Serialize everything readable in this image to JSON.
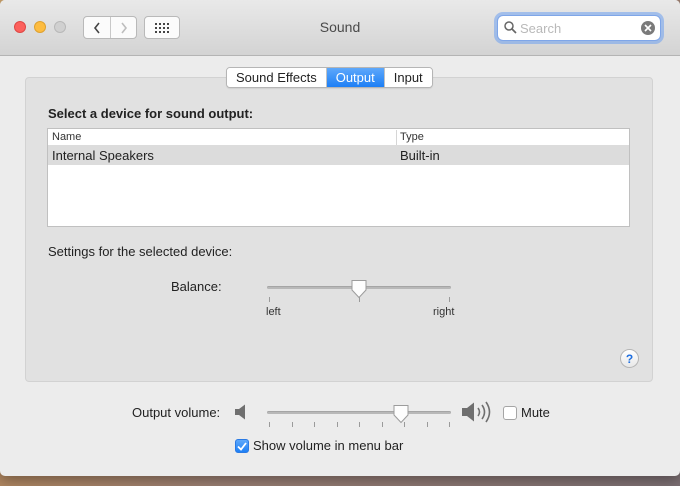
{
  "window": {
    "title": "Sound"
  },
  "search": {
    "placeholder": "Search"
  },
  "tabs": [
    {
      "label": "Sound Effects",
      "active": false
    },
    {
      "label": "Output",
      "active": true
    },
    {
      "label": "Input",
      "active": false
    }
  ],
  "output": {
    "section_title": "Select a device for sound output:",
    "columns": [
      "Name",
      "Type"
    ],
    "devices": [
      {
        "name": "Internal Speakers",
        "type": "Built-in",
        "selected": true
      }
    ],
    "settings_label": "Settings for the selected device:",
    "balance": {
      "label": "Balance:",
      "left_label": "left",
      "right_label": "right",
      "value": 0.5
    }
  },
  "footer": {
    "output_volume_label": "Output volume:",
    "volume_value": 0.73,
    "mute_label": "Mute",
    "mute_checked": false,
    "show_volume_label": "Show volume in menu bar",
    "show_volume_checked": true
  },
  "colors": {
    "accent": "#1d7ff5",
    "close": "#fc605c",
    "minimize": "#fdbc40"
  },
  "icons": {
    "back": "chevron-left-icon",
    "forward": "chevron-right-icon",
    "show_all": "grid-icon",
    "search": "magnifier-icon",
    "clear": "clear-icon",
    "help": "help-icon",
    "speaker_low": "speaker-low-icon",
    "speaker_high": "speaker-high-icon"
  }
}
